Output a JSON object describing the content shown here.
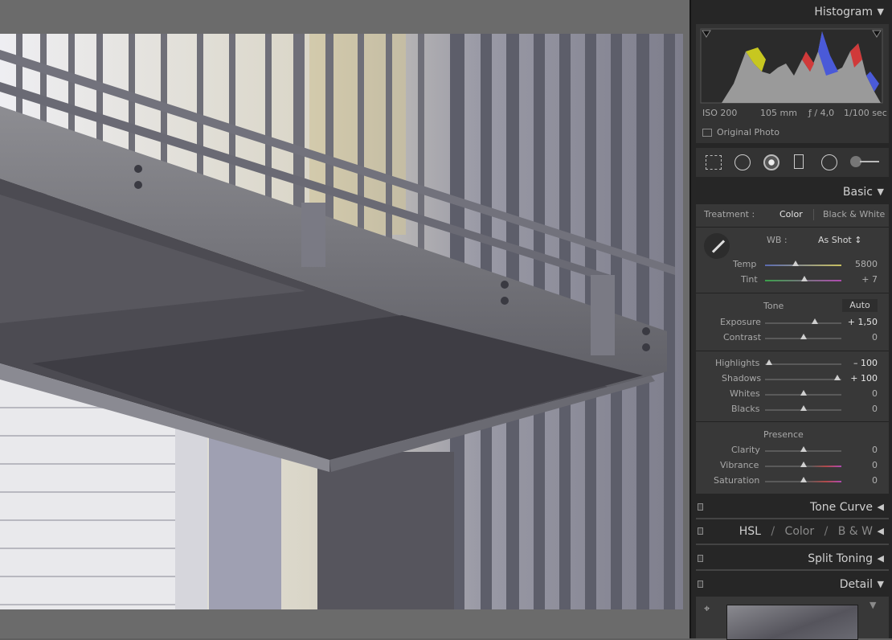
{
  "histogram": {
    "title": "Histogram",
    "iso": "ISO 200",
    "focal": "105 mm",
    "aperture": "ƒ / 4,0",
    "shutter": "1/100 sec",
    "original_photo_label": "Original Photo"
  },
  "tools": [
    "crop-overlay-icon",
    "spot-removal-icon",
    "red-eye-icon",
    "graduated-filter-icon",
    "radial-filter-icon",
    "adjustment-brush-icon"
  ],
  "basic": {
    "title": "Basic",
    "treatment_label": "Treatment :",
    "treatment_color": "Color",
    "treatment_bw": "Black & White",
    "wb_label": "WB :",
    "wb_value": "As Shot ↕",
    "temp": {
      "label": "Temp",
      "value": "5800",
      "level": 0.4
    },
    "tint": {
      "label": "Tint",
      "value": "+ 7",
      "level": 0.52
    },
    "tone_label": "Tone",
    "auto_label": "Auto",
    "exposure": {
      "label": "Exposure",
      "value": "+ 1,50",
      "level": 0.65
    },
    "contrast": {
      "label": "Contrast",
      "value": "0",
      "level": 0.5
    },
    "highlights": {
      "label": "Highlights",
      "value": "– 100",
      "level": 0.05
    },
    "shadows": {
      "label": "Shadows",
      "value": "+ 100",
      "level": 0.95
    },
    "whites": {
      "label": "Whites",
      "value": "0",
      "level": 0.5
    },
    "blacks": {
      "label": "Blacks",
      "value": "0",
      "level": 0.5
    },
    "presence_label": "Presence",
    "clarity": {
      "label": "Clarity",
      "value": "0",
      "level": 0.5
    },
    "vibrance": {
      "label": "Vibrance",
      "value": "0",
      "level": 0.5
    },
    "saturation": {
      "label": "Saturation",
      "value": "0",
      "level": 0.5
    }
  },
  "panels": {
    "tone_curve": "Tone Curve",
    "hsl": "HSL",
    "slash": "/",
    "color": "Color",
    "bw": "B & W",
    "split_toning": "Split Toning",
    "detail": "Detail"
  },
  "colors": {
    "panel_bg": "#262626",
    "section_bg": "#383838",
    "text": "#d0d0d0"
  }
}
